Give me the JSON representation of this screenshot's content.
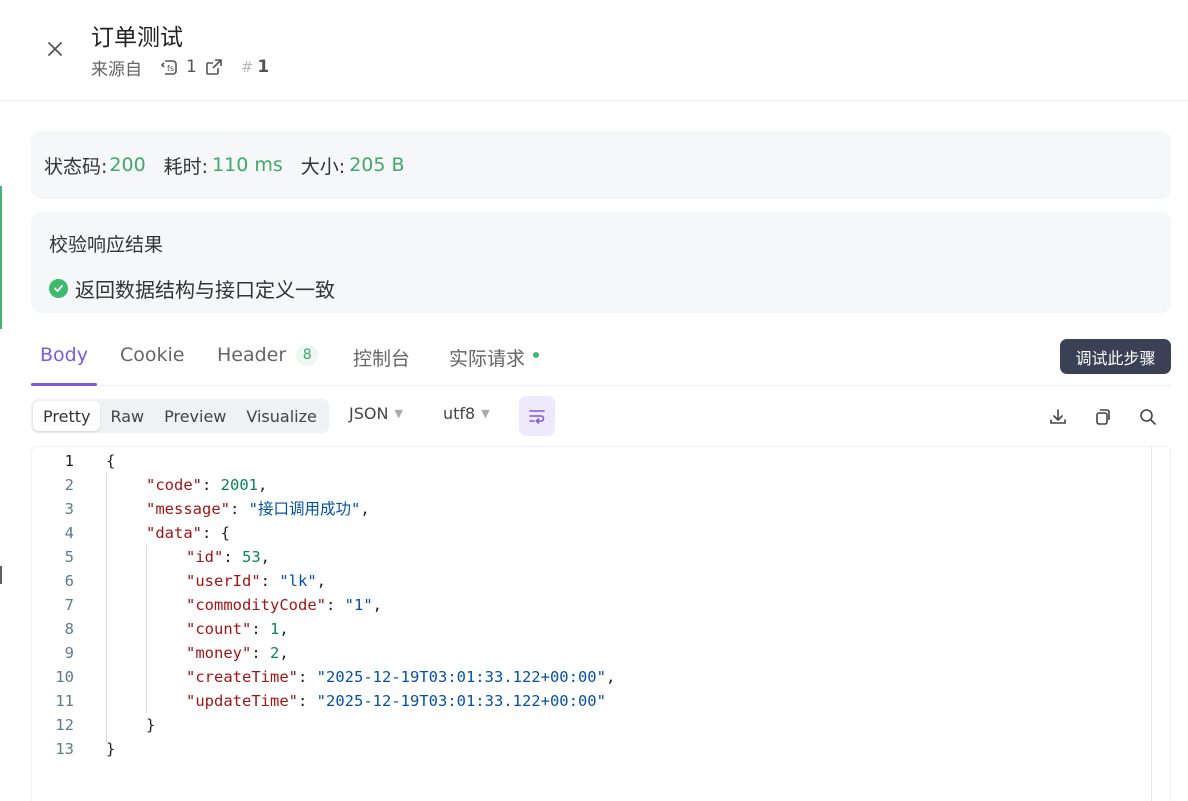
{
  "header": {
    "title": "订单测试",
    "source_label": "来源自",
    "ref_count": "1",
    "hash_number": "1"
  },
  "stats": {
    "status_label": "状态码:",
    "status_value": "200",
    "time_label": "耗时:",
    "time_value": "110 ms",
    "size_label": "大小:",
    "size_value": "205 B"
  },
  "validation": {
    "title": "校验响应结果",
    "result": "返回数据结构与接口定义一致"
  },
  "tabs": [
    {
      "label": "Body"
    },
    {
      "label": "Cookie"
    },
    {
      "label": "Header",
      "badge": "8"
    },
    {
      "label": "控制台"
    },
    {
      "label": "实际请求"
    }
  ],
  "tooltip": "调试此步骤",
  "toolbar": {
    "view_modes": [
      "Pretty",
      "Raw",
      "Preview",
      "Visualize"
    ],
    "format": "JSON",
    "encoding": "utf8"
  },
  "colors": {
    "accent": "#7a5ce0",
    "success": "#3fb96e",
    "json_key": "#a31515",
    "json_number": "#098658",
    "json_string": "#0451a5"
  },
  "code": {
    "open": "{",
    "code_key": "\"code\"",
    "code_val": "2001",
    "message_key": "\"message\"",
    "message_val": "\"接口调用成功\"",
    "data_key": "\"data\"",
    "data_open": "{",
    "id_key": "\"id\"",
    "id_val": "53",
    "userId_key": "\"userId\"",
    "userId_val": "\"lk\"",
    "commodityCode_key": "\"commodityCode\"",
    "commodityCode_val": "\"1\"",
    "count_key": "\"count\"",
    "count_val": "1",
    "money_key": "\"money\"",
    "money_val": "2",
    "createTime_key": "\"createTime\"",
    "createTime_val": "\"2025-12-19T03:01:33.122+00:00\"",
    "updateTime_key": "\"updateTime\"",
    "updateTime_val": "\"2025-12-19T03:01:33.122+00:00\"",
    "data_close": "}",
    "close": "}",
    "line_numbers": [
      "1",
      "2",
      "3",
      "4",
      "5",
      "6",
      "7",
      "8",
      "9",
      "10",
      "11",
      "12",
      "13"
    ]
  }
}
